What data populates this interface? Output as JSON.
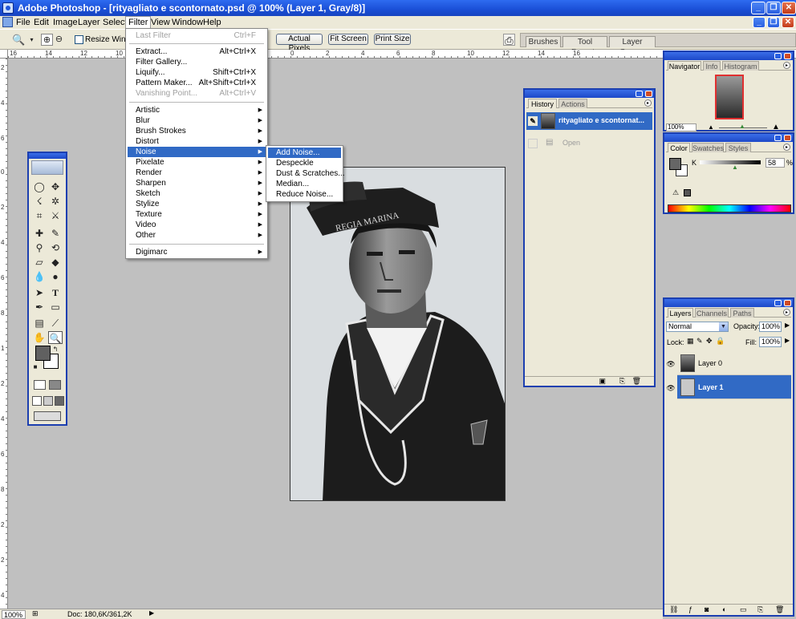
{
  "window": {
    "title": "Adobe Photoshop - [rityagliato e scontornato.psd @ 100% (Layer 1, Gray/8)]",
    "buttons": [
      "_",
      "❐",
      "✕"
    ]
  },
  "menubar": [
    "File",
    "Edit",
    "Image",
    "Layer",
    "Select",
    "Filter",
    "View",
    "Window",
    "Help"
  ],
  "options": {
    "resize_windows": "Resize Windows",
    "actual_pixels": "Actual Pixels",
    "fit_screen": "Fit Screen",
    "print_size": "Print Size",
    "well_tabs": [
      "Brushes",
      "Tool Presets",
      "Layer Comps"
    ]
  },
  "ruler_h": [
    "16",
    "14",
    "12",
    "10",
    "0",
    "2",
    "4",
    "6",
    "8",
    "10",
    "12",
    "14",
    "16"
  ],
  "ruler_v": [
    "2",
    "4",
    "6",
    "0",
    "2",
    "4",
    "6",
    "8",
    "1",
    "2",
    "4",
    "6",
    "8",
    "2",
    "2",
    "4"
  ],
  "filter_menu": {
    "last_filter": {
      "label": "Last Filter",
      "shortcut": "Ctrl+F"
    },
    "group1": [
      {
        "label": "Extract...",
        "shortcut": "Alt+Ctrl+X"
      },
      {
        "label": "Filter Gallery...",
        "shortcut": ""
      },
      {
        "label": "Liquify...",
        "shortcut": "Shift+Ctrl+X"
      },
      {
        "label": "Pattern Maker...",
        "shortcut": "Alt+Shift+Ctrl+X"
      },
      {
        "label": "Vanishing Point...",
        "shortcut": "Alt+Ctrl+V"
      }
    ],
    "group2": [
      "Artistic",
      "Blur",
      "Brush Strokes",
      "Distort",
      "Noise",
      "Pixelate",
      "Render",
      "Sharpen",
      "Sketch",
      "Stylize",
      "Texture",
      "Video",
      "Other"
    ],
    "group3": [
      "Digimarc"
    ]
  },
  "noise_menu": [
    "Add Noise...",
    "Despeckle",
    "Dust & Scratches...",
    "Median...",
    "Reduce Noise..."
  ],
  "history": {
    "tabs": [
      "History",
      "Actions"
    ],
    "snapshot": "rityagliato e scontornat...",
    "step": "Open"
  },
  "navigator": {
    "tabs": [
      "Navigator",
      "Info",
      "Histogram"
    ],
    "zoom": "100%"
  },
  "color": {
    "tabs": [
      "Color",
      "Swatches",
      "Styles"
    ],
    "channel": "K",
    "value": "58",
    "unit": "%"
  },
  "layers": {
    "tabs": [
      "Layers",
      "Channels",
      "Paths"
    ],
    "blend_mode": "Normal",
    "opacity_label": "Opacity:",
    "opacity": "100%",
    "lock_label": "Lock:",
    "fill_label": "Fill:",
    "fill": "100%",
    "items": [
      {
        "name": "Layer 0",
        "selected": false
      },
      {
        "name": "Layer 1",
        "selected": true
      }
    ]
  },
  "status": {
    "zoom": "100%",
    "doc": "Doc: 180,6K/361,2K"
  },
  "canvas_text": "REGIA MARINA"
}
